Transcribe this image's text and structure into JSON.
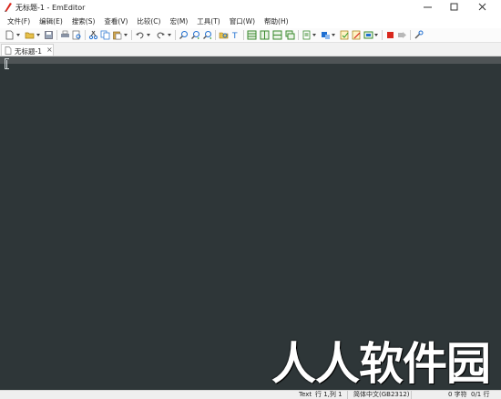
{
  "window": {
    "title": "无标题-1 - EmEditor",
    "minimize_glyph": "─",
    "maximize_glyph": "☐",
    "close_glyph": "✕"
  },
  "menu": {
    "items": [
      {
        "label": "文件(F)"
      },
      {
        "label": "编辑(E)"
      },
      {
        "label": "搜索(S)"
      },
      {
        "label": "查看(V)"
      },
      {
        "label": "比较(C)"
      },
      {
        "label": "宏(M)"
      },
      {
        "label": "工具(T)"
      },
      {
        "label": "窗口(W)"
      },
      {
        "label": "帮助(H)"
      }
    ]
  },
  "tabs": [
    {
      "label": "无标题-1",
      "close": "×"
    }
  ],
  "status": {
    "mode": "Text",
    "position": "行 1,列 1",
    "encoding": "简体中文(GB2312)",
    "chars": "0 字符",
    "lines": "0/1 行"
  },
  "watermark": {
    "text": "人人软件园"
  },
  "colors": {
    "editor_bg": "#2e3638",
    "ruler_bg": "#4f5456",
    "accent_blue": "#1f6fd1",
    "accent_red": "#d9281e"
  }
}
